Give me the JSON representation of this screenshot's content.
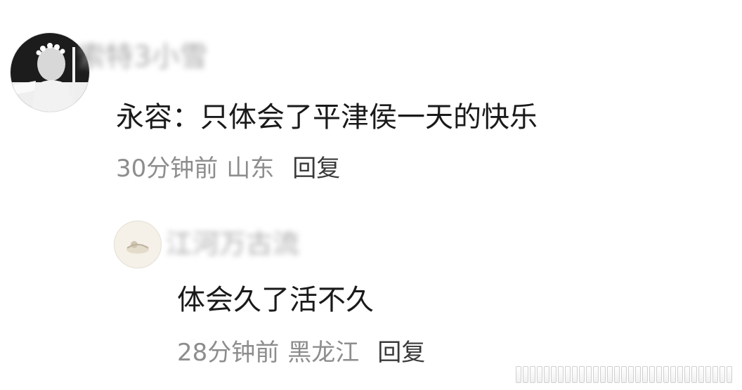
{
  "comments": [
    {
      "username": "索特3小雪",
      "text": "永容：只体会了平津侯一天的快乐",
      "time": "30分钟前",
      "location": "山东",
      "reply_label": "回复",
      "avatar_icon": "bw-portrait-avatar"
    },
    {
      "username": "江河万古流",
      "text": "体会久了活不久",
      "time": "28分钟前",
      "location": "黑龙江",
      "reply_label": "回复",
      "avatar_icon": "beige-sketch-avatar"
    }
  ]
}
